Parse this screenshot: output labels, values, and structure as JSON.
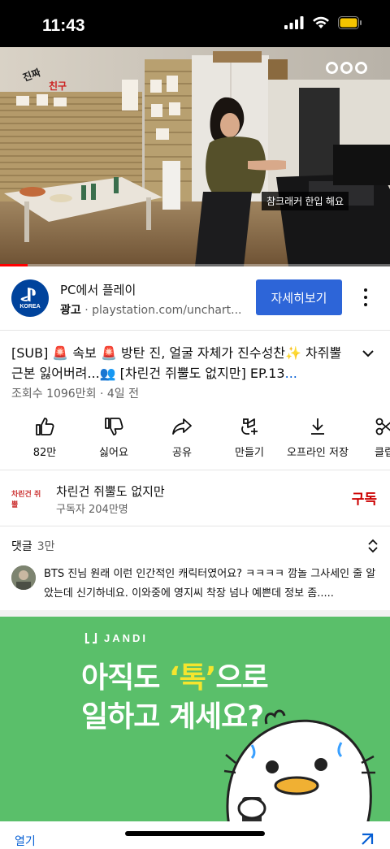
{
  "status": {
    "time": "11:43"
  },
  "video": {
    "caption": "참크래커 한입 해요",
    "progress": 0.07,
    "logo_left": "진짜 친구들 생긴 날",
    "watermark": "ᴄᴄᴄ"
  },
  "ad": {
    "logo_text": "KOREA",
    "title": "PC에서 플레이",
    "label": "광고",
    "separator": "·",
    "domain": "playstation.com/unchart...",
    "cta": "자세히보기"
  },
  "video_info": {
    "title_main": "[SUB] 🚨 속보 🚨  방탄 진, 얼굴 자체가 진수성찬✨  차쥐뿔 근본 잃어버려...👥  [차린건 쥐뿔도 없지만] EP.13",
    "title_more": "...",
    "views": "조회수 1096만회",
    "dot": "·",
    "age": "4일 전"
  },
  "actions": [
    {
      "label": "82만",
      "icon": "thumb-up-icon"
    },
    {
      "label": "싫어요",
      "icon": "thumb-down-icon"
    },
    {
      "label": "공유",
      "icon": "share-icon"
    },
    {
      "label": "만들기",
      "icon": "create-icon"
    },
    {
      "label": "오프라인 저장",
      "icon": "download-icon"
    },
    {
      "label": "클립",
      "icon": "clip-icon"
    }
  ],
  "channel": {
    "avatar_text": "차린건 쥐뿔",
    "name": "차린건 쥐뿔도 없지만",
    "subscribers": "구독자 204만명",
    "subscribe": "구독"
  },
  "comments": {
    "label": "댓글",
    "count": "3만",
    "top_comment": "BTS 진님 원래 이런 인간적인 캐릭터였어요? ㅋㅋㅋㅋ 깜놀 그사세인 줄 알았는데 신기하네요. 이와중에 영지씨 착장 넘나 예쁜데 정보 좀....."
  },
  "banner": {
    "brand": "JANDI",
    "line1_pre": "아직도 ",
    "line1_hl": "‘톡’",
    "line1_post": "으로",
    "line2": "일하고 계세요?"
  },
  "bottom": {
    "open": "열기"
  },
  "colors": {
    "accent": "#2d65d8",
    "subscribe": "#cc0000",
    "banner": "#5abf6a",
    "highlight": "#f5e52e"
  }
}
